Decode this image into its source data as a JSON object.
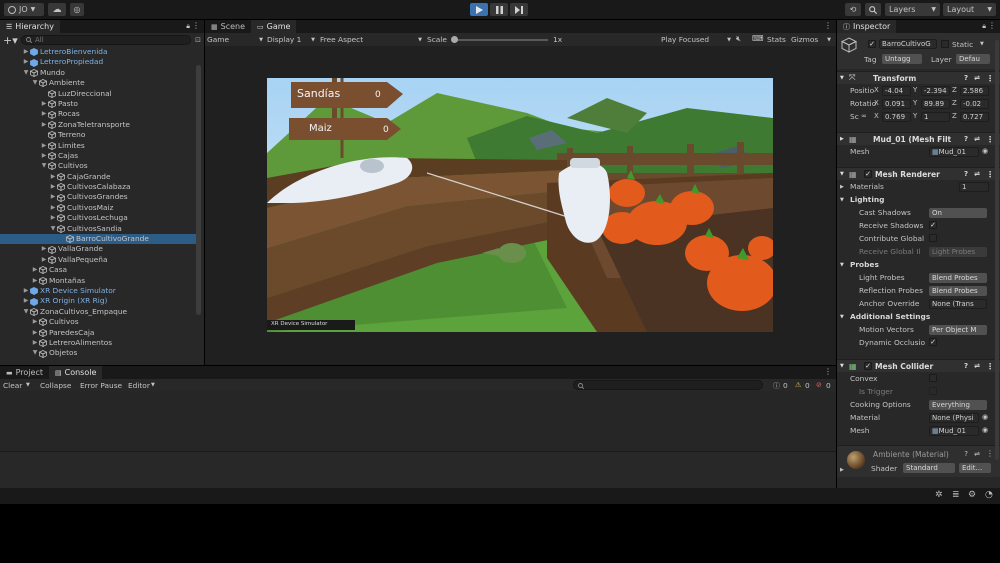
{
  "toolbar": {
    "account_label": "JO",
    "layers_label": "Layers",
    "layout_label": "Layout"
  },
  "hierarchy": {
    "tab_label": "Hierarchy",
    "search_placeholder": "All",
    "items": [
      {
        "label": "LetreroBienvenida",
        "indent": 2,
        "arrow": "▶",
        "kind": "prefab"
      },
      {
        "label": "LetreroPropiedad",
        "indent": 2,
        "arrow": "▶",
        "kind": "prefab"
      },
      {
        "label": "Mundo",
        "indent": 2,
        "arrow": "▼",
        "kind": "obj"
      },
      {
        "label": "Ambiente",
        "indent": 3,
        "arrow": "▼",
        "kind": "obj"
      },
      {
        "label": "LuzDireccional",
        "indent": 4,
        "arrow": "",
        "kind": "obj"
      },
      {
        "label": "Pasto",
        "indent": 4,
        "arrow": "▶",
        "kind": "obj"
      },
      {
        "label": "Rocas",
        "indent": 4,
        "arrow": "▶",
        "kind": "obj"
      },
      {
        "label": "ZonaTeletransporte",
        "indent": 4,
        "arrow": "▶",
        "kind": "obj"
      },
      {
        "label": "Terreno",
        "indent": 4,
        "arrow": "",
        "kind": "obj"
      },
      {
        "label": "Limites",
        "indent": 4,
        "arrow": "▶",
        "kind": "obj"
      },
      {
        "label": "Cajas",
        "indent": 4,
        "arrow": "▶",
        "kind": "obj"
      },
      {
        "label": "Cultivos",
        "indent": 4,
        "arrow": "▼",
        "kind": "obj"
      },
      {
        "label": "CajaGrande",
        "indent": 5,
        "arrow": "▶",
        "kind": "obj"
      },
      {
        "label": "CultivosCalabaza",
        "indent": 5,
        "arrow": "▶",
        "kind": "obj"
      },
      {
        "label": "CultivosGrandes",
        "indent": 5,
        "arrow": "▶",
        "kind": "obj"
      },
      {
        "label": "CultivosMaiz",
        "indent": 5,
        "arrow": "▶",
        "kind": "obj"
      },
      {
        "label": "CultivosLechuga",
        "indent": 5,
        "arrow": "▶",
        "kind": "obj"
      },
      {
        "label": "CultivosSandia",
        "indent": 5,
        "arrow": "▼",
        "kind": "obj"
      },
      {
        "label": "BarroCultivoGrande",
        "indent": 6,
        "arrow": "",
        "kind": "obj",
        "selected": true
      },
      {
        "label": "VallaGrande",
        "indent": 4,
        "arrow": "▶",
        "kind": "obj"
      },
      {
        "label": "VallaPequeña",
        "indent": 4,
        "arrow": "▶",
        "kind": "obj"
      },
      {
        "label": "Casa",
        "indent": 3,
        "arrow": "▶",
        "kind": "obj"
      },
      {
        "label": "Montañas",
        "indent": 3,
        "arrow": "▶",
        "kind": "obj"
      },
      {
        "label": "XR Device Simulator",
        "indent": 2,
        "arrow": "▶",
        "kind": "prefab"
      },
      {
        "label": "XR Origin (XR Rig)",
        "indent": 2,
        "arrow": "▶",
        "kind": "prefab"
      },
      {
        "label": "ZonaCultivos_Empaque",
        "indent": 2,
        "arrow": "▼",
        "kind": "obj"
      },
      {
        "label": "Cultivos",
        "indent": 3,
        "arrow": "▶",
        "kind": "obj"
      },
      {
        "label": "ParedesCaja",
        "indent": 3,
        "arrow": "▶",
        "kind": "obj"
      },
      {
        "label": "LetreroAlimentos",
        "indent": 3,
        "arrow": "▶",
        "kind": "obj"
      },
      {
        "label": "Objetos",
        "indent": 3,
        "arrow": "▼",
        "kind": "obj"
      }
    ]
  },
  "center": {
    "tab_scene": "Scene",
    "tab_game": "Game",
    "game_dropdown": "Game",
    "display_dropdown": "Display 1",
    "aspect_dropdown": "Free Aspect",
    "scale_label": "Scale",
    "scale_value": "1x",
    "play_focused": "Play Focused",
    "stats_label": "Stats",
    "gizmos_label": "Gizmos"
  },
  "game_view": {
    "sign1_label": "Sandías",
    "sign1_count": "0",
    "sign2_label": "Maiz",
    "sign2_count": "0",
    "device_sim": "XR Device Simulator"
  },
  "bottom": {
    "tab_project": "Project",
    "tab_console": "Console",
    "clear": "Clear",
    "collapse": "Collapse",
    "error_pause": "Error Pause",
    "editor": "Editor",
    "log_count": "0",
    "warn_count": "0",
    "err_count": "0"
  },
  "inspector": {
    "tab_label": "Inspector",
    "object_name": "BarroCultivoG",
    "static_label": "Static",
    "tag_label": "Tag",
    "tag_value": "Untagg",
    "layer_label": "Layer",
    "layer_value": "Defau",
    "transform": {
      "title": "Transform",
      "position_label": "Positio",
      "rotation_label": "Rotatio",
      "scale_label": "Sc",
      "pos": [
        "-4.04",
        "-2.394",
        "2.586"
      ],
      "rot": [
        "0.091",
        "89.89",
        "-0.02"
      ],
      "scale": [
        "0.769",
        "1",
        "0.727"
      ]
    },
    "mesh_filter": {
      "title": "Mud_01 (Mesh Filt",
      "mesh_label": "Mesh",
      "mesh_value": "Mud_01"
    },
    "mesh_renderer": {
      "title": "Mesh Renderer",
      "materials_label": "Materials",
      "materials_count": "1",
      "lighting_label": "Lighting",
      "cast_shadows_label": "Cast Shadows",
      "cast_shadows_value": "On",
      "receive_shadows_label": "Receive Shadows",
      "contribute_gi_label": "Contribute Global",
      "receive_gi_label": "Receive Global Il",
      "receive_gi_value": "Light Probes",
      "probes_label": "Probes",
      "light_probes_label": "Light Probes",
      "light_probes_value": "Blend Probes",
      "reflection_probes_label": "Reflection Probes",
      "reflection_probes_value": "Blend Probes",
      "anchor_override_label": "Anchor Override",
      "anchor_override_value": "None (Trans",
      "additional_label": "Additional Settings",
      "motion_vectors_label": "Motion Vectors",
      "motion_vectors_value": "Per Object M",
      "dynamic_occlusion_label": "Dynamic Occlusio"
    },
    "mesh_collider": {
      "title": "Mesh Collider",
      "convex_label": "Convex",
      "is_trigger_label": "Is Trigger",
      "cooking_label": "Cooking Options",
      "cooking_value": "Everything",
      "material_label": "Material",
      "material_value": "None (Physi",
      "mesh_label": "Mesh",
      "mesh_value": "Mud_01"
    },
    "material": {
      "title": "Ambiente (Material)",
      "shader_label": "Shader",
      "shader_value": "Standard",
      "edit_label": "Edit..."
    }
  }
}
